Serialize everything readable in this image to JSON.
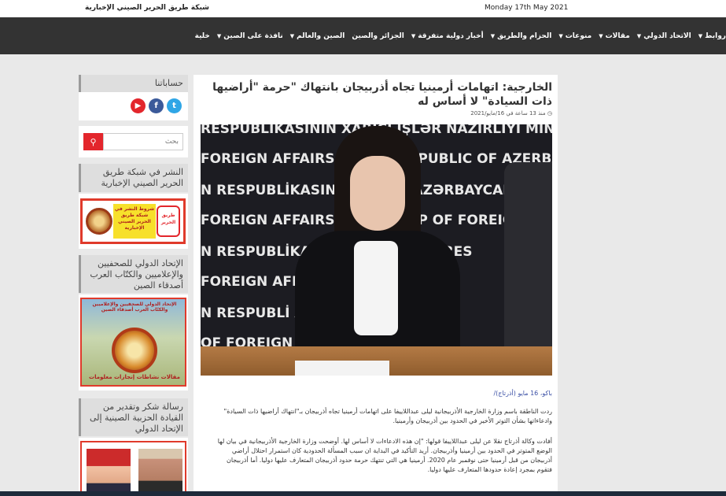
{
  "header": {
    "site_name": "شبكة طريق الحرير الصيني الإخبارية",
    "date": "Monday 17th May 2021"
  },
  "nav": [
    {
      "label": "روابط",
      "dropdown": true
    },
    {
      "label": "الاتحاد الدولي",
      "dropdown": true
    },
    {
      "label": "مقالات",
      "dropdown": true
    },
    {
      "label": "منوعات",
      "dropdown": true
    },
    {
      "label": "الحزام والطريق",
      "dropdown": true
    },
    {
      "label": "أخبار دولية متفرقة",
      "dropdown": true
    },
    {
      "label": "الجزائر والصين",
      "dropdown": false
    },
    {
      "label": "الصين والعالم",
      "dropdown": true
    },
    {
      "label": "نافذة على الصين",
      "dropdown": true
    },
    {
      "label": "خلية",
      "dropdown": false
    }
  ],
  "sidebar": {
    "accounts_title": "حساباتنا",
    "social": [
      {
        "icon": "twitter-icon",
        "glyph": "t",
        "color": "#2fa6e6"
      },
      {
        "icon": "facebook-icon",
        "glyph": "f",
        "color": "#3b5a9a"
      },
      {
        "icon": "youtube-icon",
        "glyph": "▶",
        "color": "#e3262c"
      }
    ],
    "search_placeholder": "بحث",
    "publish_title": "النشر في شبكة طريق الحرير الصيني الإخبارية",
    "ad1_text": "شروط النشر في شبكة طريق الحرير الصيني الإخبارية",
    "ad1_logo_text": "طريق الحرير",
    "union_title": "الإتحاد الدولي للصحفيين والإعلاميين والكتّاب العرب أصدقاء الصين",
    "ad2_top": "الإتحاد الدولي للصحفيين والإعلاميين والكتّاب العرب أصدقاء الصين",
    "ad2_bottom": "مقالات نشاطات إنجازات معلومات",
    "thanks_title": "رسالة شكر وتقدير من القيادة الحزبية الصينية إلى الإتحاد الدولي"
  },
  "article": {
    "title": "الخارجية: اتهامات أرمينيا تجاه أذربيجان بانتهاك \"حرمة \"أراضيها ذات السيادة\" لا أساس له",
    "meta": "منذ 13 ساعة في 16/مايو/2021",
    "photo_bg_lines": [
      "RESPUBLİKASININ XARİCİ İŞLƏR NAZİRLİYİ  MINISTRY OF",
      "FOREIGN AFFAIRS OF THE REPUBLIC OF AZERBAIJAN",
      "N RESPUBLİKASININ XARİCİ  AZƏRBAYCAN RES",
      "FOREIGN AFFAIRS OF THE REP  OF FOREIGN A",
      "N RESPUBLİKASININ  ƏRBAYCAN RES",
      "FOREIGN AFFAIRS  OF FOREIGN A",
      "N RESPUBLİ  AZƏRBAYCAN RES",
      "  OF FOREIGN A"
    ],
    "dateline": "باكو، 16 مايو (أذرتاج)/",
    "paragraph1": "ردت الناطقة باسم وزارة الخارجية الأذربيجانية ليلى عبداللاييفا على اتهامات أرمينيا تجاه أذربيجان بـ\"انتهاك أراضيها ذات السيادة\" وادعاءاتها بشأن التوتر الأخير في الحدود بين أذربيجان وأرمينيا.",
    "paragraph2": "أفادت وكالة أذرتاج نقلا عن ليلى عبداللاييفا قولها: \"إن هذه الادعاءات لا أساس لها. أوضحت وزارة الخارجية الأذربيجانية في بيان لها الوضع المتوتر في الحدود بين أرمينيا وأذربيجان. أريد التأكيد في البداية ان سبب المسألة الحدودية كان استمرار احتلال أراضي أذربيجان من قبل أرمينيا حتى نوفمبر عام 2020. أرمينيا هي التي تنتهك حرمة حدود أذربيجان المتعارف عليها دوليا. أما أذربيجان فتقوم بمجرد إعادة حدودها المتعارف عليها دوليا."
  }
}
